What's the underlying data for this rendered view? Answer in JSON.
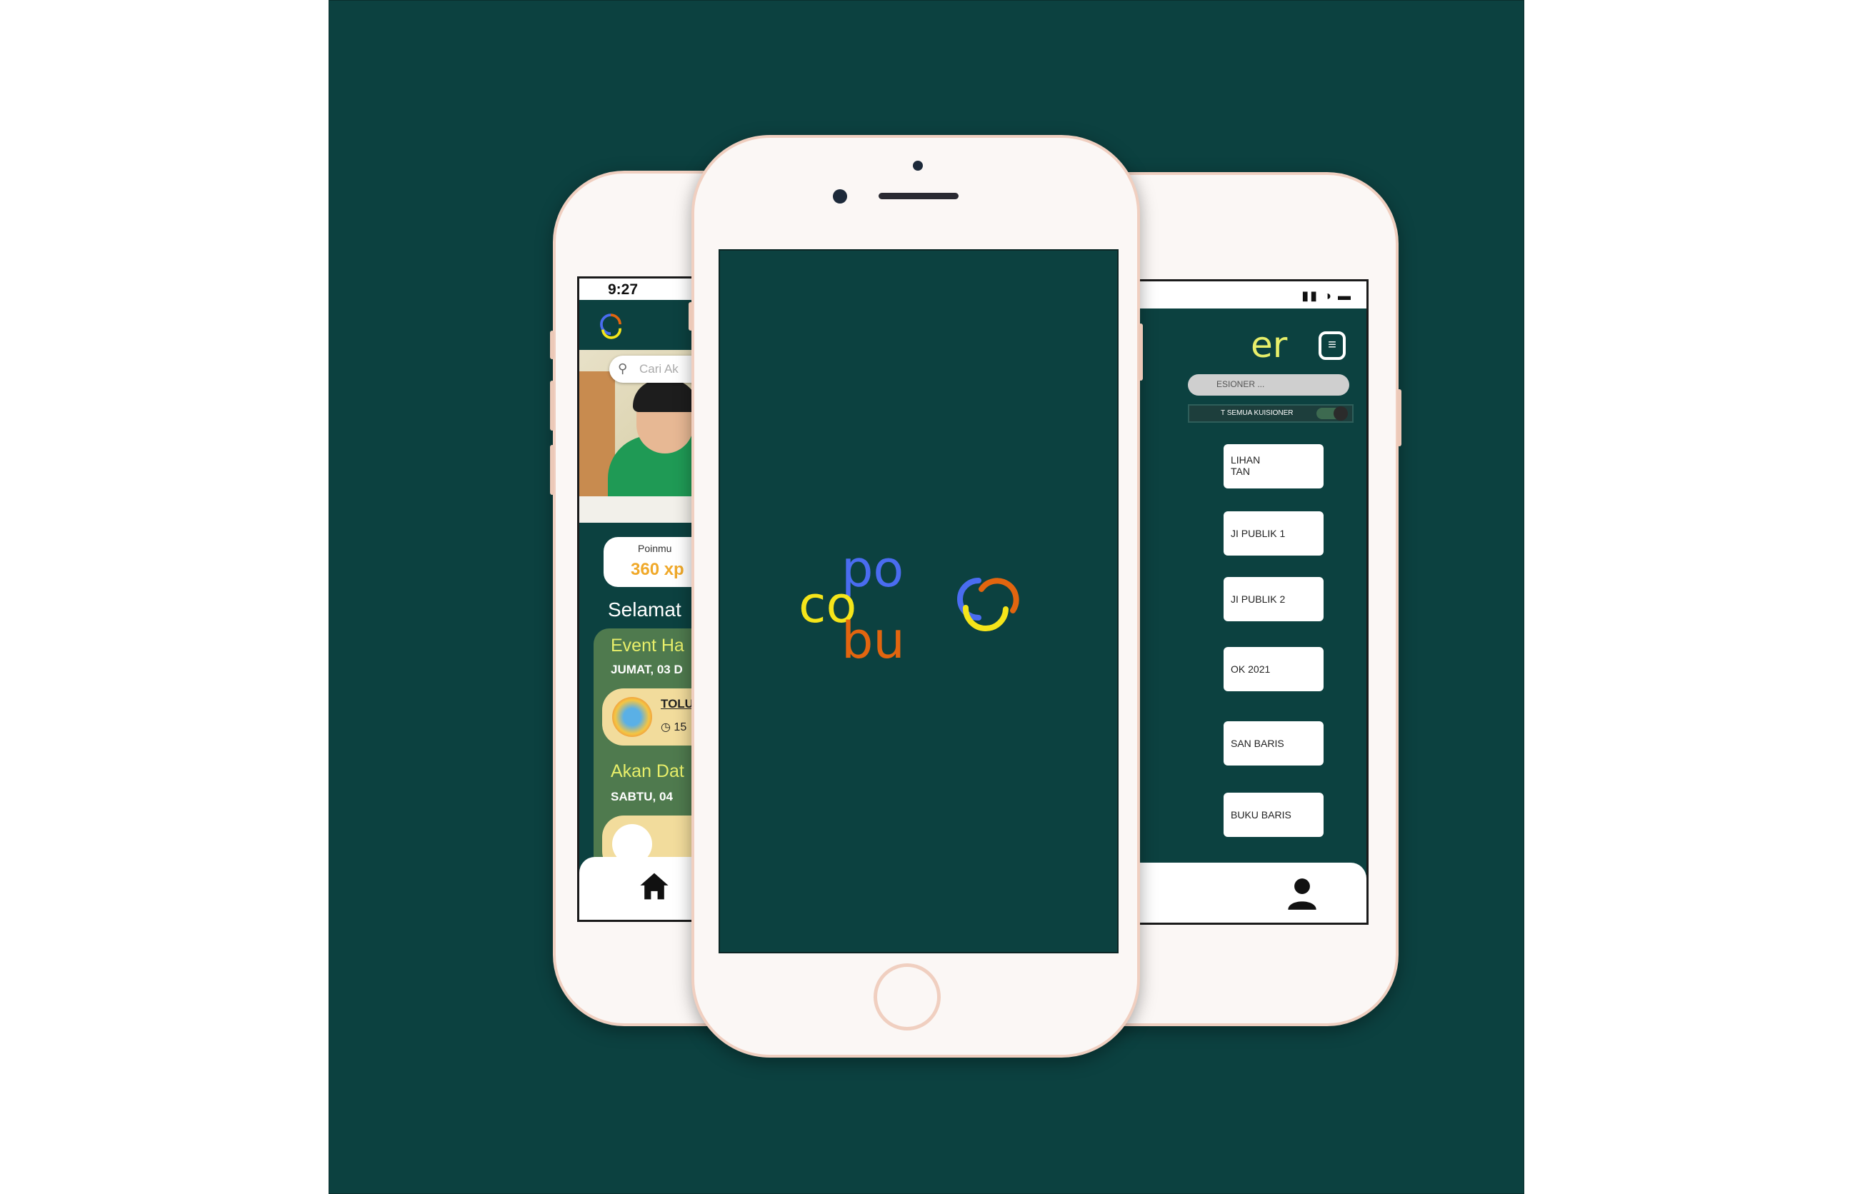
{
  "colors": {
    "background": "#0c4140",
    "accent_yellow": "#e8ef6a",
    "logo_blue": "#4a6cf0",
    "logo_yellow": "#f5e51a",
    "logo_orange": "#e2650f",
    "points_orange": "#f0a92a"
  },
  "left_phone": {
    "status_time": "9:27",
    "search_placeholder": "Cari Ak",
    "points_label": "Poinmu",
    "points_value": "360 xp",
    "greeting": "Selamat",
    "event_today_title": "Event Ha",
    "event_today_date": "JUMAT, 03 D",
    "event_today_name": "TOLU",
    "event_today_time": "15",
    "event_upcoming_title": "Akan Dat",
    "event_upcoming_date": "SABTU, 04",
    "nav_icon": "home-icon"
  },
  "center_phone": {
    "logo_letters": [
      "po",
      "co",
      "bu"
    ],
    "logo_icon": "cobupo-rings-icon"
  },
  "right_phone": {
    "title_fragment": "er",
    "search_placeholder": "ESIONER ...",
    "toggle_label": "T SEMUA KUISIONER",
    "items": [
      "LIHAN\nTAN",
      "JI PUBLIK 1",
      "JI PUBLIK 2",
      "OK 2021",
      "SAN BARIS",
      "BUKU BARIS"
    ],
    "nav_icon": "profile-icon"
  }
}
